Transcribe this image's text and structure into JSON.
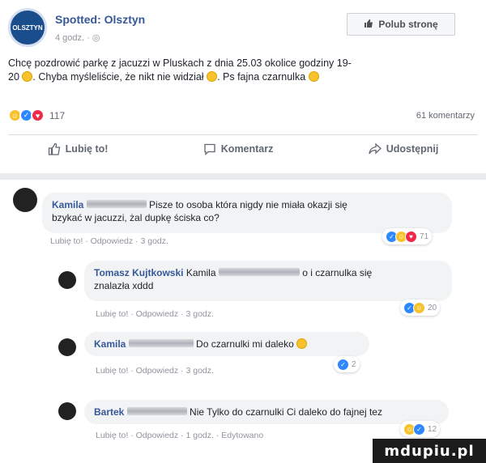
{
  "post": {
    "page_name": "Spotted: Olsztyn",
    "avatar_text": "OLSZTYN",
    "time": "4 godz.",
    "like_page_label": "Polub stronę",
    "text_line1": "Chcę pozdrowić parkę z jacuzzi w Pluskach z dnia 25.03 okolice godziny 19-",
    "text_line2a": "20",
    "text_line2b": ". Chyba myśleliście, że nikt nie widział",
    "text_line2c": ". Ps fajna czarnulka",
    "reaction_count": "117",
    "comment_count": "61 komentarzy"
  },
  "actions": {
    "like": "Lubię to!",
    "comment": "Komentarz",
    "share": "Udostępnij"
  },
  "comments": [
    {
      "author": "Kamila",
      "text_a": "Pisze to osoba która nigdy nie miała okazji się",
      "text_b": "bzykać w jacuzzi, żal dupkę ściska co?",
      "meta": "Lubię to! · Odpowiedz · 3 godz.",
      "reactions": "71"
    },
    {
      "author": "Tomasz Kujtkowski",
      "text_a": "Kamila",
      "text_b": "o i czarnulka się",
      "text_c": "znalazła xddd",
      "meta": "Lubię to! · Odpowiedz · 3 godz.",
      "reactions": "20"
    },
    {
      "author": "Kamila",
      "text_a": "Do czarnulki mi daleko",
      "meta": "Lubię to! · Odpowiedz · 3 godz.",
      "reactions": "2"
    },
    {
      "author": "Bartek",
      "text_a": "Nie Tylko do czarnulki Ci daleko do fajnej tez",
      "meta": "Lubię to! · Odpowiedz · 1 godz. · Edytowano",
      "reactions": "12"
    }
  ],
  "watermark": "mdupiu.pl",
  "colors": {
    "link": "#365899",
    "like_blue": "#2d88ff",
    "love_red": "#f0284a",
    "haha_yellow": "#f7c22c"
  }
}
